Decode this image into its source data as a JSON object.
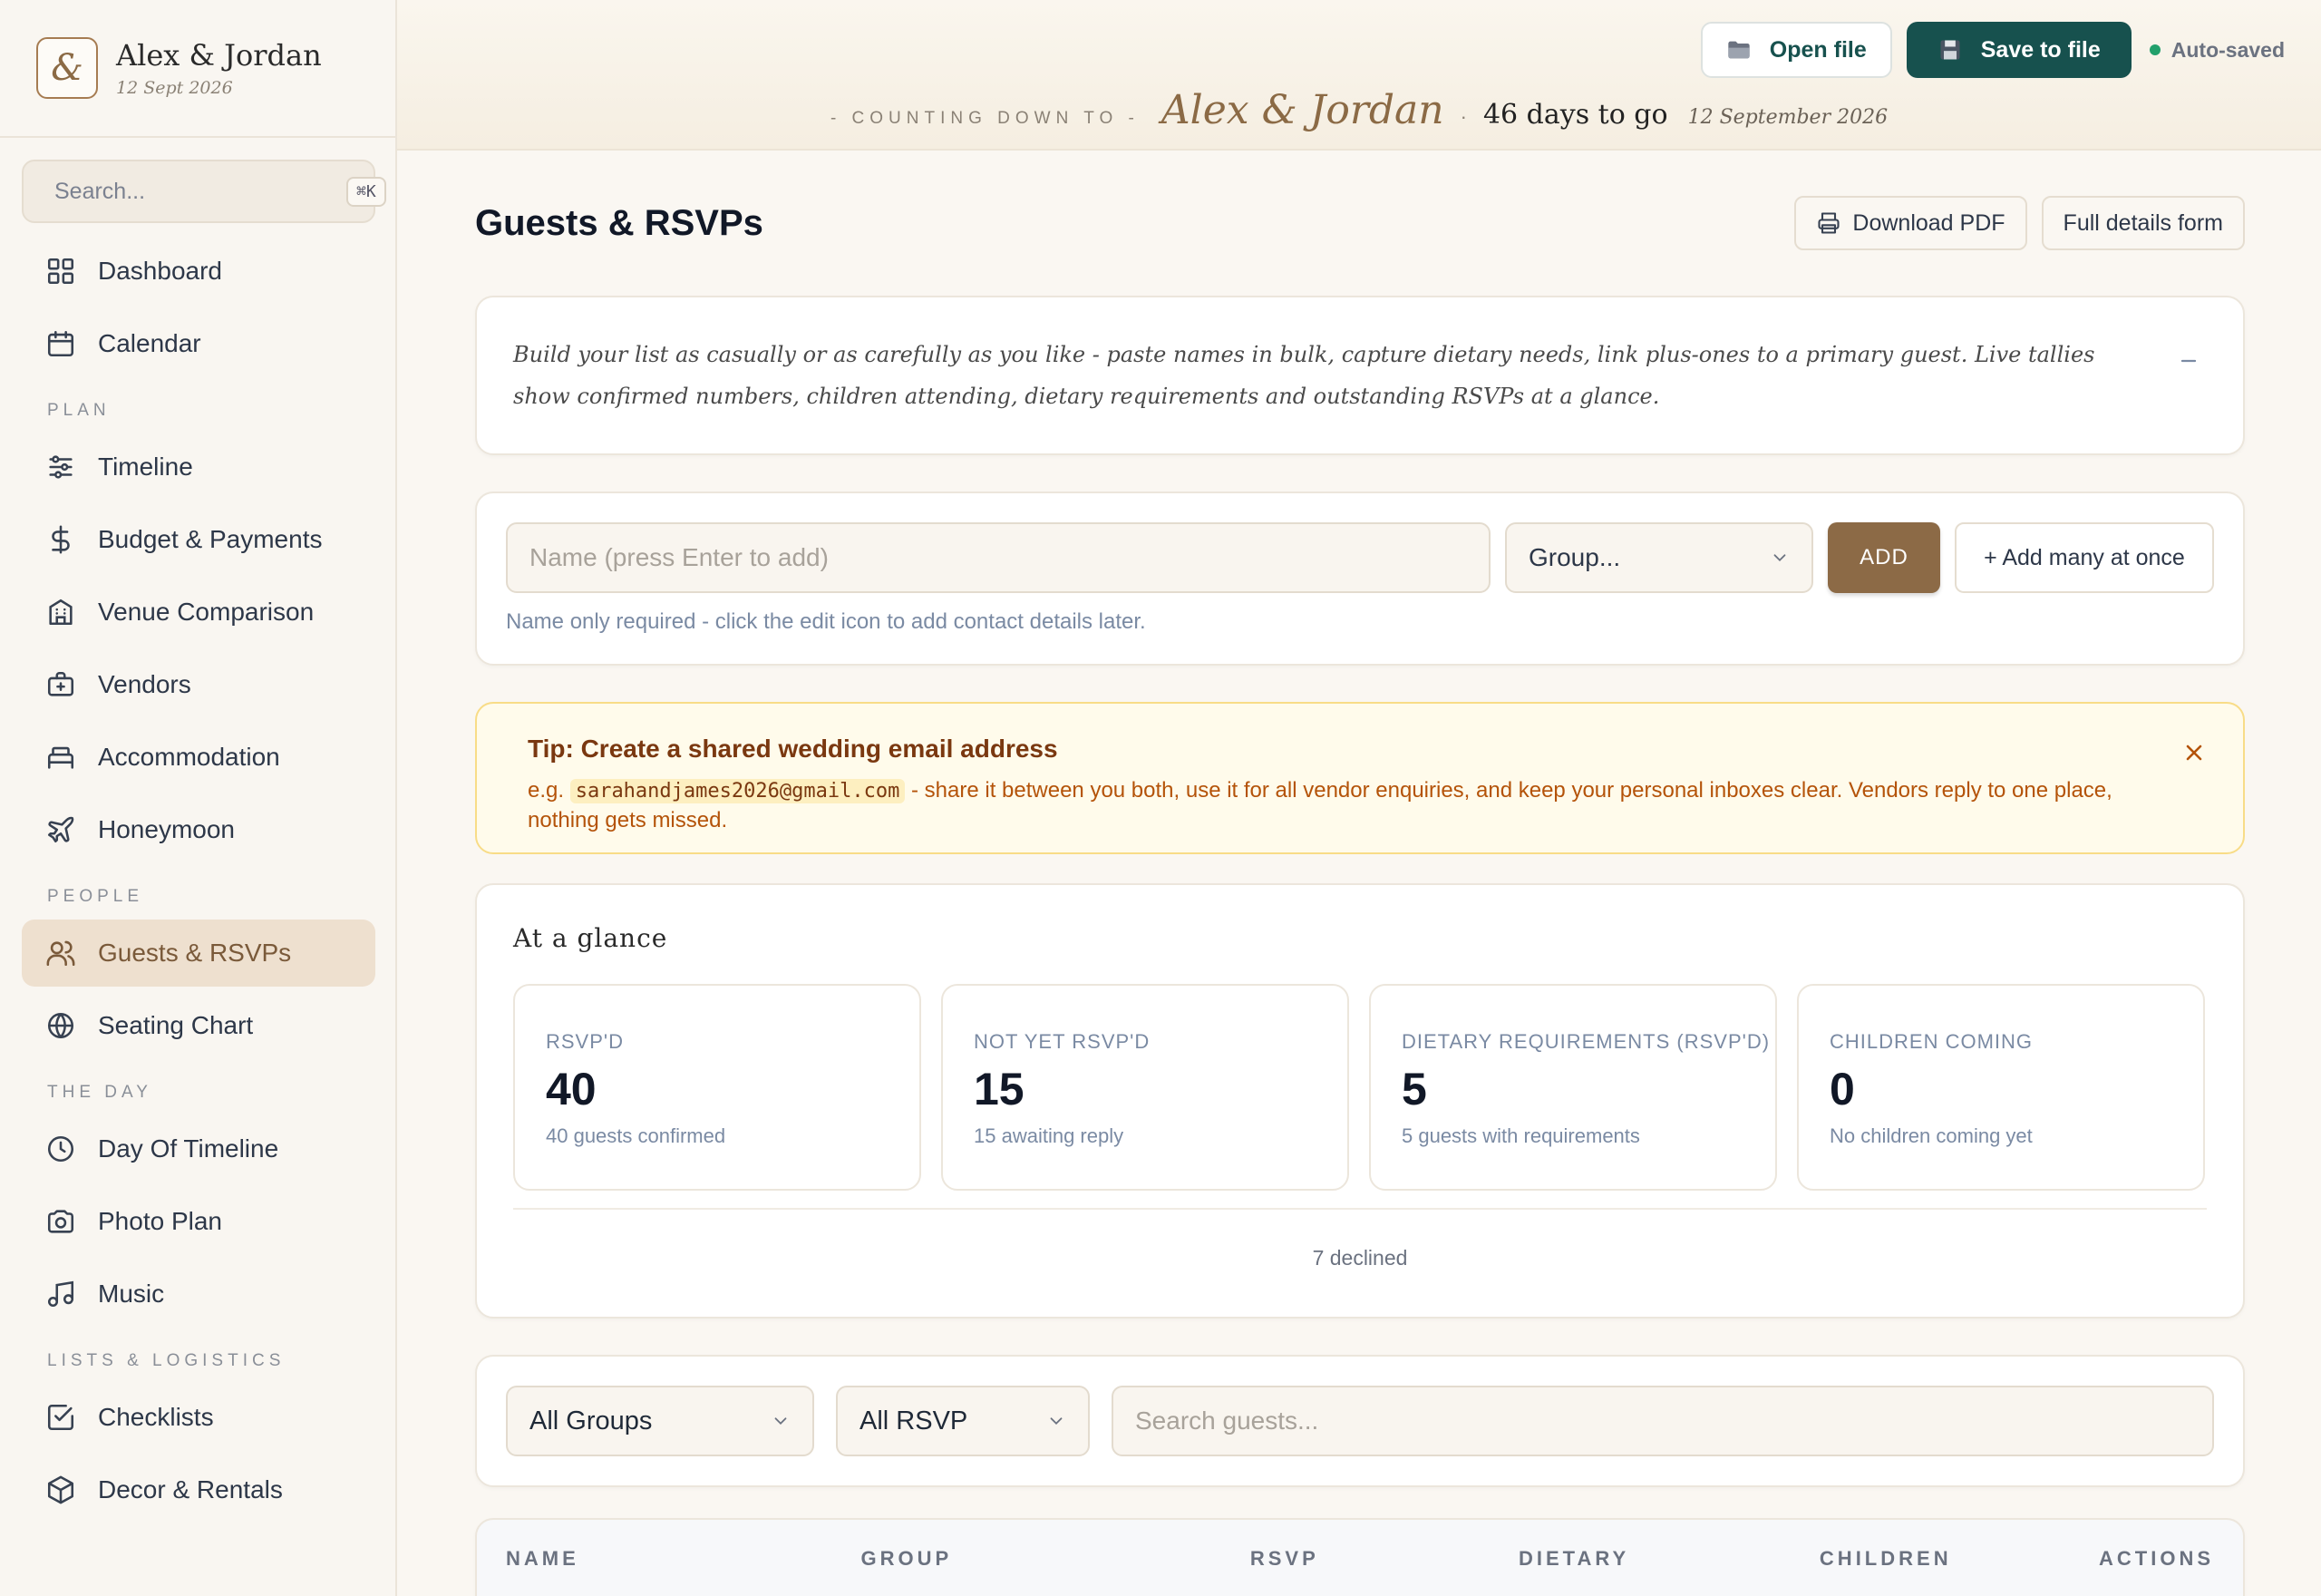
{
  "brand": {
    "mark": "&",
    "name": "Alex & Jordan",
    "date": "12 Sept 2026"
  },
  "sidebar": {
    "search_placeholder": "Search...",
    "shortcut": "⌘K",
    "top_items": [
      {
        "label": "Dashboard",
        "icon": "grid-icon"
      },
      {
        "label": "Calendar",
        "icon": "calendar-icon"
      }
    ],
    "sections": [
      {
        "title": "PLAN",
        "items": [
          {
            "label": "Timeline",
            "icon": "sliders-icon"
          },
          {
            "label": "Budget & Payments",
            "icon": "dollar-icon"
          },
          {
            "label": "Venue Comparison",
            "icon": "building-icon"
          },
          {
            "label": "Vendors",
            "icon": "briefcase-icon"
          },
          {
            "label": "Accommodation",
            "icon": "bed-icon"
          },
          {
            "label": "Honeymoon",
            "icon": "plane-icon"
          }
        ]
      },
      {
        "title": "PEOPLE",
        "items": [
          {
            "label": "Guests & RSVPs",
            "icon": "users-icon",
            "active": true
          },
          {
            "label": "Seating Chart",
            "icon": "globe-icon"
          }
        ]
      },
      {
        "title": "THE DAY",
        "items": [
          {
            "label": "Day Of Timeline",
            "icon": "clock-icon"
          },
          {
            "label": "Photo Plan",
            "icon": "camera-icon"
          },
          {
            "label": "Music",
            "icon": "music-icon"
          }
        ]
      },
      {
        "title": "LISTS & LOGISTICS",
        "items": [
          {
            "label": "Checklists",
            "icon": "checkbox-icon"
          },
          {
            "label": "Decor & Rentals",
            "icon": "box-icon"
          }
        ]
      }
    ]
  },
  "topbar": {
    "open_label": "Open file",
    "save_label": "Save to file",
    "autosave_label": "Auto-saved",
    "countdown_label": "- COUNTING DOWN TO -",
    "countdown_names": "Alex & Jordan",
    "countdown_sep": "·",
    "countdown_days": "46 days to go",
    "countdown_date": "12 September 2026"
  },
  "page": {
    "title": "Guests & RSVPs",
    "download_label": "Download PDF",
    "form_label": "Full details form",
    "intro": "Build your list as casually or as carefully as you like - paste names in bulk, capture dietary needs, link plus-ones to a primary guest. Live tallies show confirmed numbers, children attending, dietary requirements and outstanding RSVPs at a glance."
  },
  "add_guest": {
    "name_placeholder": "Name (press Enter to add)",
    "group_placeholder": "Group...",
    "add_label": "ADD",
    "add_many_label": "+ Add many at once",
    "hint": "Name only required - click the edit icon to add contact details later."
  },
  "tip": {
    "title": "Tip: Create a shared wedding email address",
    "prefix": "e.g.",
    "email": "sarahandjames2026@gmail.com",
    "body": "- share it between you both, use it for all vendor enquiries, and keep your personal inboxes clear. Vendors reply to one place, nothing gets missed."
  },
  "glance": {
    "title": "At a glance",
    "stats": [
      {
        "label": "RSVP'D",
        "value": "40",
        "sub": "40 guests confirmed"
      },
      {
        "label": "NOT YET RSVP'D",
        "value": "15",
        "sub": "15 awaiting reply"
      },
      {
        "label": "DIETARY REQUIREMENTS (RSVP'D)",
        "value": "5",
        "sub": "5 guests with requirements"
      },
      {
        "label": "CHILDREN COMING",
        "value": "0",
        "sub": "No children coming yet"
      }
    ],
    "declined": "7 declined"
  },
  "filters": {
    "group": "All Groups",
    "rsvp": "All RSVP",
    "search_placeholder": "Search guests..."
  },
  "table": {
    "columns": [
      "NAME",
      "GROUP",
      "RSVP",
      "DIETARY",
      "CHILDREN",
      "ACTIONS"
    ]
  },
  "colors": {
    "accent": "#17514e",
    "brand_brown": "#8c6a46",
    "active_bg": "#eee0cf",
    "tip_bg": "#fffbeb",
    "tip_text": "#b45309",
    "autosave_dot": "#22a06b"
  }
}
